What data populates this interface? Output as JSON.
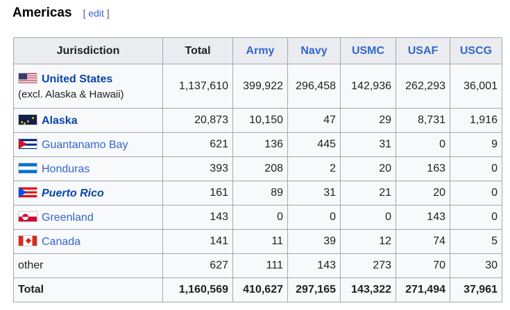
{
  "section": {
    "title": "Americas",
    "edit_open": "[ ",
    "edit_label": "edit",
    "edit_close": " ]"
  },
  "table": {
    "headers": {
      "jurisdiction": "Jurisdiction",
      "total": "Total",
      "army": "Army",
      "navy": "Navy",
      "usmc": "USMC",
      "usaf": "USAF",
      "uscg": "USCG"
    },
    "rows": [
      {
        "name": "United States",
        "note": "(excl. Alaska & Hawaii)",
        "flag": "us-flag-icon",
        "total": "1,137,610",
        "army": "399,922",
        "navy": "296,458",
        "usmc": "142,936",
        "usaf": "262,293",
        "uscg": "36,001"
      },
      {
        "name": "Alaska",
        "flag": "alaska-flag-icon",
        "total": "20,873",
        "army": "10,150",
        "navy": "47",
        "usmc": "29",
        "usaf": "8,731",
        "uscg": "1,916"
      },
      {
        "name": "Guantanamo Bay",
        "flag": "cuba-flag-icon",
        "total": "621",
        "army": "136",
        "navy": "445",
        "usmc": "31",
        "usaf": "0",
        "uscg": "9"
      },
      {
        "name": "Honduras",
        "flag": "honduras-flag-icon",
        "total": "393",
        "army": "208",
        "navy": "2",
        "usmc": "20",
        "usaf": "163",
        "uscg": "0"
      },
      {
        "name": "Puerto Rico",
        "flag": "puerto-rico-flag-icon",
        "total": "161",
        "army": "89",
        "navy": "31",
        "usmc": "21",
        "usaf": "20",
        "uscg": "0"
      },
      {
        "name": "Greenland",
        "flag": "greenland-flag-icon",
        "total": "143",
        "army": "0",
        "navy": "0",
        "usmc": "0",
        "usaf": "143",
        "uscg": "0"
      },
      {
        "name": "Canada",
        "flag": "canada-flag-icon",
        "total": "141",
        "army": "11",
        "navy": "39",
        "usmc": "12",
        "usaf": "74",
        "uscg": "5"
      },
      {
        "name": "other",
        "total": "627",
        "army": "111",
        "navy": "143",
        "usmc": "273",
        "usaf": "70",
        "uscg": "30"
      }
    ],
    "footer": {
      "label": "Total",
      "total": "1,160,569",
      "army": "410,627",
      "navy": "297,165",
      "usmc": "143,322",
      "usaf": "271,494",
      "uscg": "37,961"
    }
  },
  "colors": {
    "link": "#3366cc",
    "link_bold": "#0645ad",
    "header_bg": "#eaecf0",
    "table_bg": "#f8f9fa",
    "border": "#a2a9b1"
  }
}
